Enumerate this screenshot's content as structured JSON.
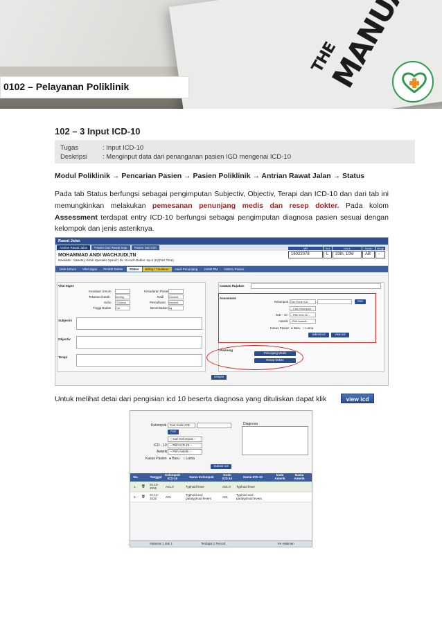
{
  "header": {
    "section_title": "0102 – Pelayanan Poliklinik",
    "banner_text_top": "THE",
    "banner_text_main": "MANUAL"
  },
  "heading": "102 – 3 Input ICD-10",
  "task": {
    "tugas_label": "Tugas",
    "tugas_value": ": Input ICD-10",
    "deskripsi_label": "Deskripsi",
    "deskripsi_value": ": Menginput data dari  penanganan pasien IGD mengenai ICD-10"
  },
  "modul_path": "Modul Poliklinik → Pencarian Pasien → Pasien Poliklinik → Antrian Rawat Jalan → Status",
  "paragraph": {
    "p1": "Pada tab Status berfungsi sebagai pengimputan Subjectiv, Objectiv, Terapi dan ICD-10 dan dari tab ini memungkinkan melakukan ",
    "p1_bold": "pemesanan penunjang medis dan resep dokter.",
    "p2": " Pada kolom ",
    "p2_bold": "Assessment",
    "p3": " terdapat entry ICD-10 berfungsi sebagai pengimputan diagnosa pasien sesuai dengan kelompok dan jenis asteriknya."
  },
  "screenshot1": {
    "title": "Rawat Jalan",
    "top_tabs": [
      "Antrian Rawat Jalan",
      "Pasien Dari Rawat Inap",
      "Pasien Dari IGD"
    ],
    "patient_name": "MOHAMMAD ANDI WACHJUDI,TN",
    "patient_sub": "Nasabah : Swasta,( Klinik Spesialis Syaraf ) Dr. H.Hoch.Dalbar. Sp.S (K)(Part Time)",
    "info_headers": [
      "MR",
      "Sex",
      "Umur",
      "Darah",
      "Alergi"
    ],
    "info_values": [
      "16022078",
      "L",
      "33th, 10M",
      "AB",
      "-"
    ],
    "status_tabs": [
      "Data Umum",
      "Vital Signs",
      "Pindah Dokter",
      "Status",
      "Billing / Tindakan",
      "Hasil Penunjang",
      "Cetak RM",
      "History Pasien"
    ],
    "vital_signs": "Vital Signs",
    "keadaan_umum": "Keadaan Umum",
    "tekanan_darah": "Tekanan Darah",
    "suhu": "Suhu",
    "tinggi_badan": "Tinggi Badan",
    "kesadaran_pasien": "Kesadaran Pasien",
    "nadi": "Nadi",
    "pernafasan": "Pernafasan",
    "berat_badan": "Berat Badan",
    "unit_mmhg": "mmHg",
    "unit_celcius": "°Celcius",
    "unit_cm": "Cm",
    "unit_xmenit": "x/menit",
    "unit_xmenit2": "x/menit",
    "unit_kg": "kg",
    "subjectiv": "Subjectiv",
    "objectiv": "Objectiv",
    "terapi": "Terapi",
    "catatan_rujukan": "Catatan Rujukan",
    "assesment": "Assesment",
    "kelompok": "Kelompok",
    "cari_kode_icd": "Cari Kode ICD",
    "cari": "Cari",
    "cari_kelompok": "-- Cari Kelompok --",
    "icd10": "ICD - 10",
    "pilih_icd10": "-- Pilih ICD-10 --",
    "asterik": "Asterik",
    "pilih_asterik": "--Pilih Asterik--",
    "kasus_pasien": "Kasus Pasien",
    "baru": "Baru",
    "lama": "Lama",
    "submit_icd": "submit icd",
    "view_icd": "view icd",
    "planning": "Planning",
    "penunjang_medis": "Penunjang Medis",
    "resep_dokter": "Resep Dokter",
    "simpan": "Simpan"
  },
  "see_text": "Untuk melihat detai dari pengisian icd 10 beserta diagnosa yang dituliskan dapat klik",
  "view_icd_button": "view icd",
  "screenshot2": {
    "kelompok": "Kelompok",
    "cari_kode": "Cari Kode ICD",
    "cari": "Cari",
    "cari_kelompok": "-- Cari Kelompok --",
    "icd10": "ICD - 10",
    "pilih_icd10": "-- Pilih ICD-10 --",
    "asterik": "Asterik",
    "pilih_asterik": "-- Pilih Asterik --",
    "kasus_pasien": "Kasus Pasien",
    "baru": "Baru",
    "lama": "Lama",
    "submit_icd": "Submit icd",
    "diagnosa": "Diagnosa",
    "columns": [
      "No.",
      "",
      "Tanggal",
      "Kelompok ICD-10",
      "Nama Kelompok",
      "Kode ICD-10",
      "Nama ICD-10",
      "kode Asterik",
      "Nama Asterik"
    ],
    "rows": [
      {
        "no": "1.",
        "tanggal": "01-12-2016",
        "kelompok": "A01.0",
        "nama_kelompok": "Typhoid fever",
        "kode": "A01.0",
        "nama_icd": "Typhoid fever"
      },
      {
        "no": "2.",
        "tanggal": "01-12-2016",
        "kelompok": "A01",
        "nama_kelompok": "Typhoid and paratyphoid fevers",
        "kode": "A01",
        "nama_icd": "Typhoid and paratyphoid fevers"
      }
    ],
    "pager_left": "Halaman 1 dari 1",
    "pager_mid": "Terdapat 2 Record",
    "pager_right": "Ke Halaman"
  },
  "colors": {
    "accent": "#2d4f93",
    "highlight": "#e21b1b",
    "logo_green": "#2e9a4c",
    "logo_orange": "#f08c1e"
  }
}
